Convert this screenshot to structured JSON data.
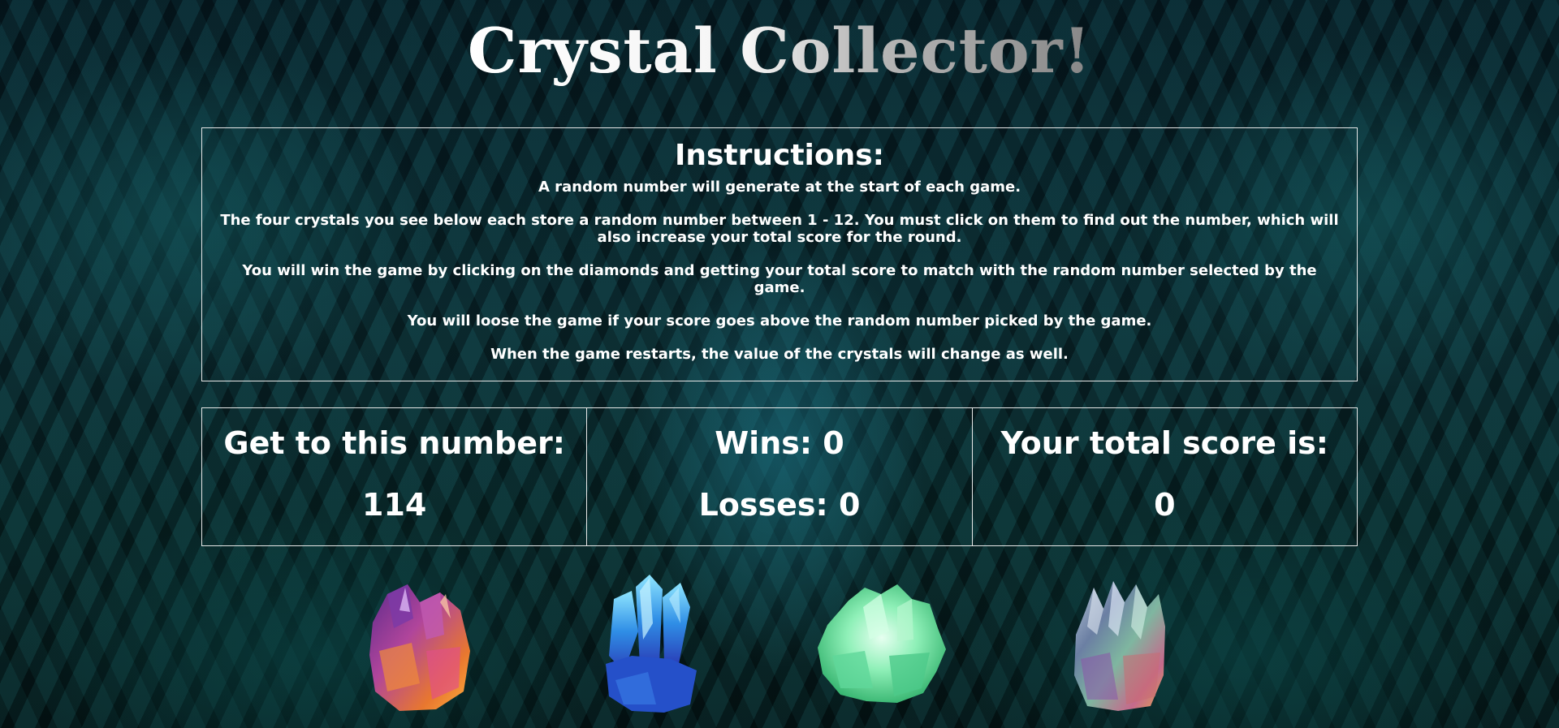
{
  "game": {
    "title": "Crystal Collector!"
  },
  "instructions": {
    "heading": "Instructions:",
    "lines": [
      "A random number will generate at the start of each game.",
      "The four crystals you see below each store a random number between 1 - 12. You must click on them to find out the number, which will also increase your total score for the round.",
      "You will win the game by clicking on the diamonds and getting your total score to match with the random number selected by the game.",
      "You will loose the game if your score goes above the random number picked by the game.",
      "When the game restarts, the value of the crystals will change as well."
    ]
  },
  "stats": {
    "target_label": "Get to this number:",
    "target_value": "114",
    "wins_text": "Wins: 0",
    "losses_text": "Losses: 0",
    "score_label": "Your total score is:",
    "score_value": "0"
  },
  "crystals": [
    {
      "name": "purple-orange-crystal",
      "color": "#b0459b"
    },
    {
      "name": "blue-crystal",
      "color": "#2f8ee6"
    },
    {
      "name": "green-crystal",
      "color": "#5fd79a"
    },
    {
      "name": "rainbow-crystal",
      "color": "#7a8aa0"
    }
  ]
}
